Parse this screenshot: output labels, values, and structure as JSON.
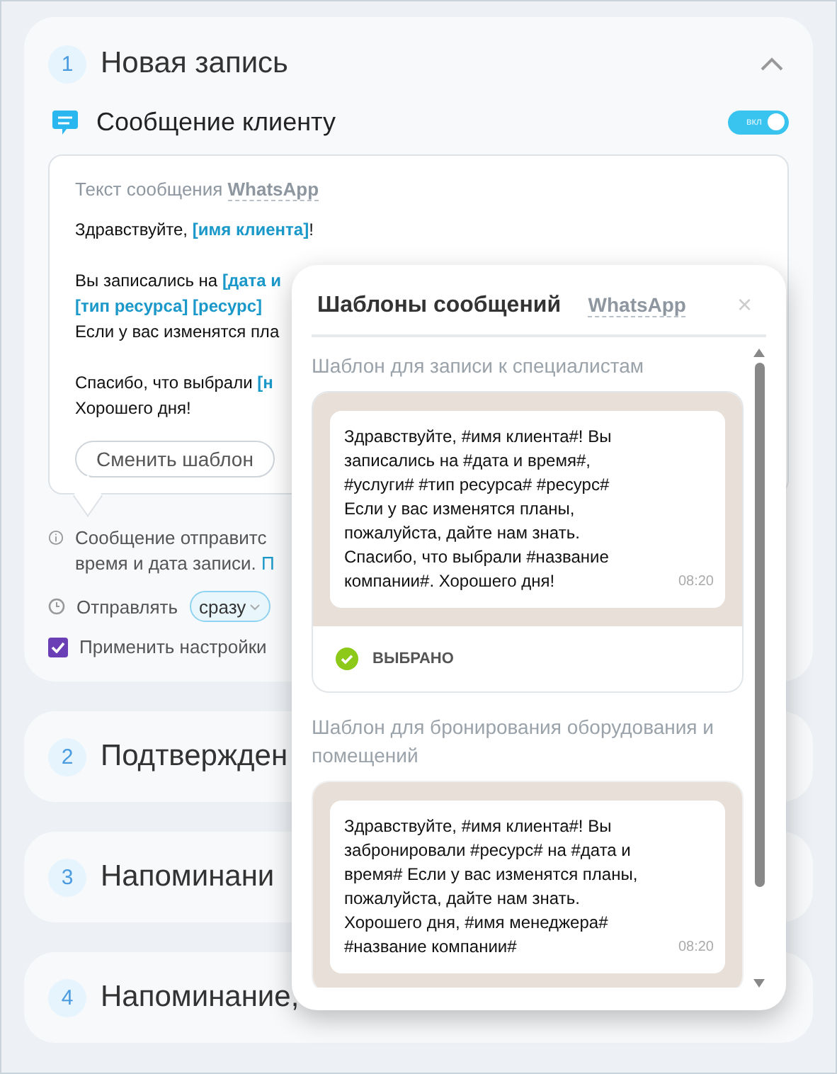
{
  "steps": [
    {
      "number": "1",
      "title": "Новая запись",
      "expanded": true
    },
    {
      "number": "2",
      "title": "Подтвержден",
      "expanded": false
    },
    {
      "number": "3",
      "title": "Напоминани",
      "expanded": false
    },
    {
      "number": "4",
      "title": "Напоминание,",
      "expanded": false
    }
  ],
  "message": {
    "title": "Сообщение клиенту",
    "enabled": true,
    "toggle_label": "вкл",
    "label": "Текст сообщения",
    "channel": "WhatsApp",
    "paragraphs": [
      [
        [
          {
            "kind": "text",
            "text": "Здравствуйте, "
          },
          {
            "kind": "var",
            "text": "[имя клиента]"
          },
          {
            "kind": "text",
            "text": "!"
          }
        ]
      ],
      [
        [
          {
            "kind": "text",
            "text": "Вы записались на "
          },
          {
            "kind": "var",
            "text": "[дата и"
          }
        ],
        [
          {
            "kind": "var",
            "text": "[тип ресурса] [ресурс]"
          }
        ],
        [
          {
            "kind": "text",
            "text": "Если у вас изменятся пла"
          }
        ]
      ],
      [
        [
          {
            "kind": "text",
            "text": "Спасибо, что выбрали "
          },
          {
            "kind": "var",
            "text": "[н"
          }
        ],
        [
          {
            "kind": "text",
            "text": "Хорошего дня!"
          }
        ]
      ]
    ],
    "button": "Сменить шаблон"
  },
  "info": {
    "lines": [
      "Сообщение отправитс",
      "время и дата записи."
    ],
    "link": "П"
  },
  "send": {
    "label": "Отправлять",
    "value": "сразу"
  },
  "apply": {
    "label": "Применить настройки",
    "checked": true
  },
  "templates_popup": {
    "title": "Шаблоны сообщений",
    "channel": "WhatsApp",
    "close": "×",
    "templates": [
      {
        "title": "Шаблон для записи к специалистам",
        "text": "Здравствуйте, #имя клиента#! Вы\nзаписались на #дата и время#,\n#услуги# #тип ресурса# #ресурс#\nЕсли у вас изменятся планы,\nпожалуйста, дайте нам знать.\nСпасибо, что выбрали #название\nкомпании#. Хорошего дня!",
        "time": "08:20",
        "selected": true,
        "status_label": "ВЫБРАНО"
      },
      {
        "title": "Шаблон для бронирования оборудования и помещений",
        "text": "Здравствуйте, #имя клиента#! Вы\nзабронировали #ресурс# на #дата и\nвремя# Если у вас изменятся планы,\nпожалуйста, дайте нам знать.\nХорошего дня, #имя менеджера#\n#название компании#",
        "time": "08:20",
        "selected": false
      }
    ]
  }
}
